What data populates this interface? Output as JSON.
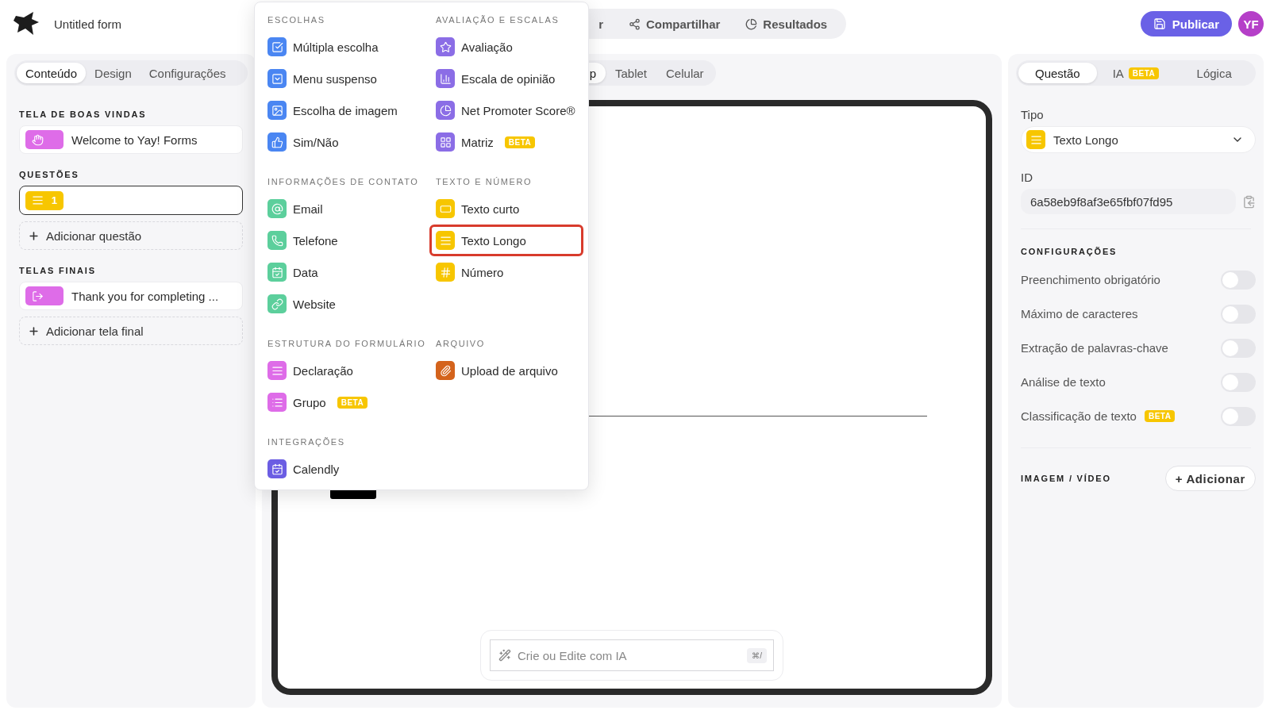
{
  "header": {
    "form_title": "Untitled form",
    "nav_tabs": [
      {
        "label": "r",
        "kind": "plain",
        "selected": false
      },
      {
        "label": "Compartilhar",
        "kind": "share",
        "selected": false
      },
      {
        "label": "Resultados",
        "kind": "pie",
        "selected": false
      }
    ],
    "publish_button": "Publicar",
    "avatar": "YF"
  },
  "left_panel": {
    "tabs": [
      {
        "label": "Conteúdo",
        "selected": true
      },
      {
        "label": "Design",
        "selected": false
      },
      {
        "label": "Configurações",
        "selected": false
      }
    ],
    "welcome": {
      "heading": "TELA DE BOAS VINDAS",
      "items": [
        {
          "label": "Welcome to Yay! Forms",
          "kind": "hand",
          "color": "#de6ce8",
          "selected": false
        }
      ]
    },
    "questions": {
      "heading": "QUESTÕES",
      "items": [
        {
          "number": "1",
          "kind": "lines",
          "color": "#f7c600",
          "selected": true
        }
      ],
      "add": "Adicionar questão"
    },
    "endings": {
      "heading": "TELAS FINAIS",
      "items": [
        {
          "label": "Thank you for completing ...",
          "kind": "exit",
          "color": "#de6ce8",
          "selected": false
        }
      ],
      "add": "Adicionar tela final"
    }
  },
  "preview": {
    "device_tabs": [
      {
        "label": "p",
        "selected": true
      },
      {
        "label": "Tablet",
        "selected": false
      },
      {
        "label": "Celular",
        "selected": false
      }
    ],
    "ai_field": {
      "placeholder": "Crie ou Edite com IA",
      "shortcut": "⌘/"
    }
  },
  "type_menu": {
    "sections": [
      {
        "heading": "ESCOLHAS",
        "items": [
          {
            "label": "Múltipla escolha",
            "kind": "checkbox",
            "color": "#4a86f2",
            "highlighted": false
          },
          {
            "label": "Menu suspenso",
            "kind": "dropdown",
            "color": "#4a86f2",
            "highlighted": false
          },
          {
            "label": "Escolha de imagem",
            "kind": "image",
            "color": "#4a86f2",
            "highlighted": false
          },
          {
            "label": "Sim/Não",
            "kind": "thumb",
            "color": "#4a86f2",
            "highlighted": false
          }
        ]
      },
      {
        "heading": "AVALIAÇÃO E ESCALAS",
        "items": [
          {
            "label": "Avaliação",
            "kind": "star",
            "color": "#8b6de6",
            "highlighted": false
          },
          {
            "label": "Escala de opinião",
            "kind": "bars",
            "color": "#8b6de6",
            "highlighted": false
          },
          {
            "label": "Net Promoter Score®",
            "kind": "pie",
            "color": "#8b6de6",
            "highlighted": false
          },
          {
            "label": "Matriz",
            "kind": "grid",
            "color": "#8b6de6",
            "badge": "BETA",
            "highlighted": false
          }
        ]
      },
      {
        "heading": "INFORMAÇÕES DE CONTATO",
        "items": [
          {
            "label": "Email",
            "kind": "at",
            "color": "#5ccf9c",
            "highlighted": false
          },
          {
            "label": "Telefone",
            "kind": "phone",
            "color": "#5ccf9c",
            "highlighted": false
          },
          {
            "label": "Data",
            "kind": "calendar",
            "color": "#5ccf9c",
            "highlighted": false
          },
          {
            "label": "Website",
            "kind": "link",
            "color": "#5ccf9c",
            "highlighted": false
          }
        ]
      },
      {
        "heading": "TEXTO E NÚMERO",
        "items": [
          {
            "label": "Texto curto",
            "kind": "short",
            "color": "#f7c600",
            "highlighted": false
          },
          {
            "label": "Texto Longo",
            "kind": "lines",
            "color": "#f7c600",
            "highlighted": true
          },
          {
            "label": "Número",
            "kind": "hash",
            "color": "#f7c600",
            "highlighted": false
          }
        ]
      },
      {
        "heading": "ESTRUTURA DO FORMULÁRIO",
        "items": [
          {
            "label": "Declaração",
            "kind": "lines",
            "color": "#de6ce8",
            "highlighted": false
          },
          {
            "label": "Grupo",
            "kind": "list",
            "color": "#de6ce8",
            "badge": "BETA",
            "highlighted": false
          }
        ]
      },
      {
        "heading": "ARQUIVO",
        "items": [
          {
            "label": "Upload de arquivo",
            "kind": "clip",
            "color": "#d4631c",
            "highlighted": false
          }
        ]
      },
      {
        "heading": "INTEGRAÇÕES",
        "items": [
          {
            "label": "Calendly",
            "kind": "calendar",
            "color": "#6b5de3",
            "highlighted": false
          }
        ]
      }
    ]
  },
  "right_panel": {
    "tabs": [
      {
        "label": "Questão",
        "selected": true
      },
      {
        "label": "IA",
        "badge": "BETA",
        "selected": false
      },
      {
        "label": "Lógica",
        "selected": false
      }
    ],
    "type_label": "Tipo",
    "type_value": {
      "label": "Texto Longo",
      "kind": "lines",
      "color": "#f7c600"
    },
    "id_label": "ID",
    "id_value": "6a58eb9f8af3e65fbf07fd95",
    "settings_heading": "CONFIGURAÇÕES",
    "settings": [
      {
        "label": "Preenchimento obrigatório",
        "on": false
      },
      {
        "label": "Máximo de caracteres",
        "on": false
      },
      {
        "label": "Extração de palavras-chave",
        "on": false
      },
      {
        "label": "Análise de texto",
        "on": false
      },
      {
        "label": "Classificação de texto",
        "badge": "BETA",
        "on": false
      }
    ],
    "media_heading": "IMAGEM / VÍDEO",
    "media_button": "+ Adicionar"
  }
}
